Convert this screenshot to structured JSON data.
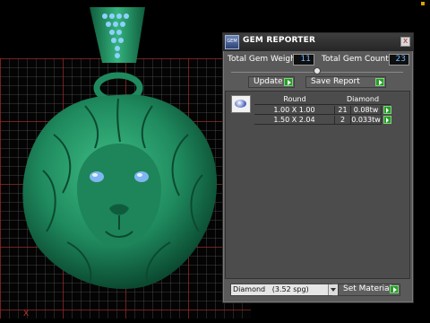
{
  "panel": {
    "title": "GEM REPORTER",
    "icon_text": "GEM",
    "close_glyph": "x",
    "total_weight_label": "Total Gem Weight",
    "total_weight_value": "11",
    "total_count_label": "Total Gem Count",
    "total_count_value": "23",
    "update_label": "Update",
    "save_report_label": "Save Report",
    "table": {
      "headers": [
        "Round",
        "Diamond"
      ],
      "rows": [
        {
          "size": "1.00 X 1.00",
          "count": "21",
          "weight": "0.08tw"
        },
        {
          "size": "1.50 X 2.04",
          "count": "2",
          "weight": "0.033tw"
        }
      ]
    },
    "material_value": "Diamond   (3.52 spg)",
    "set_material_label": "Set Material"
  },
  "viewport": {
    "axis_mark": "X",
    "model_color": "#1f8a5e",
    "gem_color": "#7fb6f2"
  },
  "colors": {
    "accent_green": "#2a9a2a",
    "value_blue": "#6fb6ff"
  }
}
